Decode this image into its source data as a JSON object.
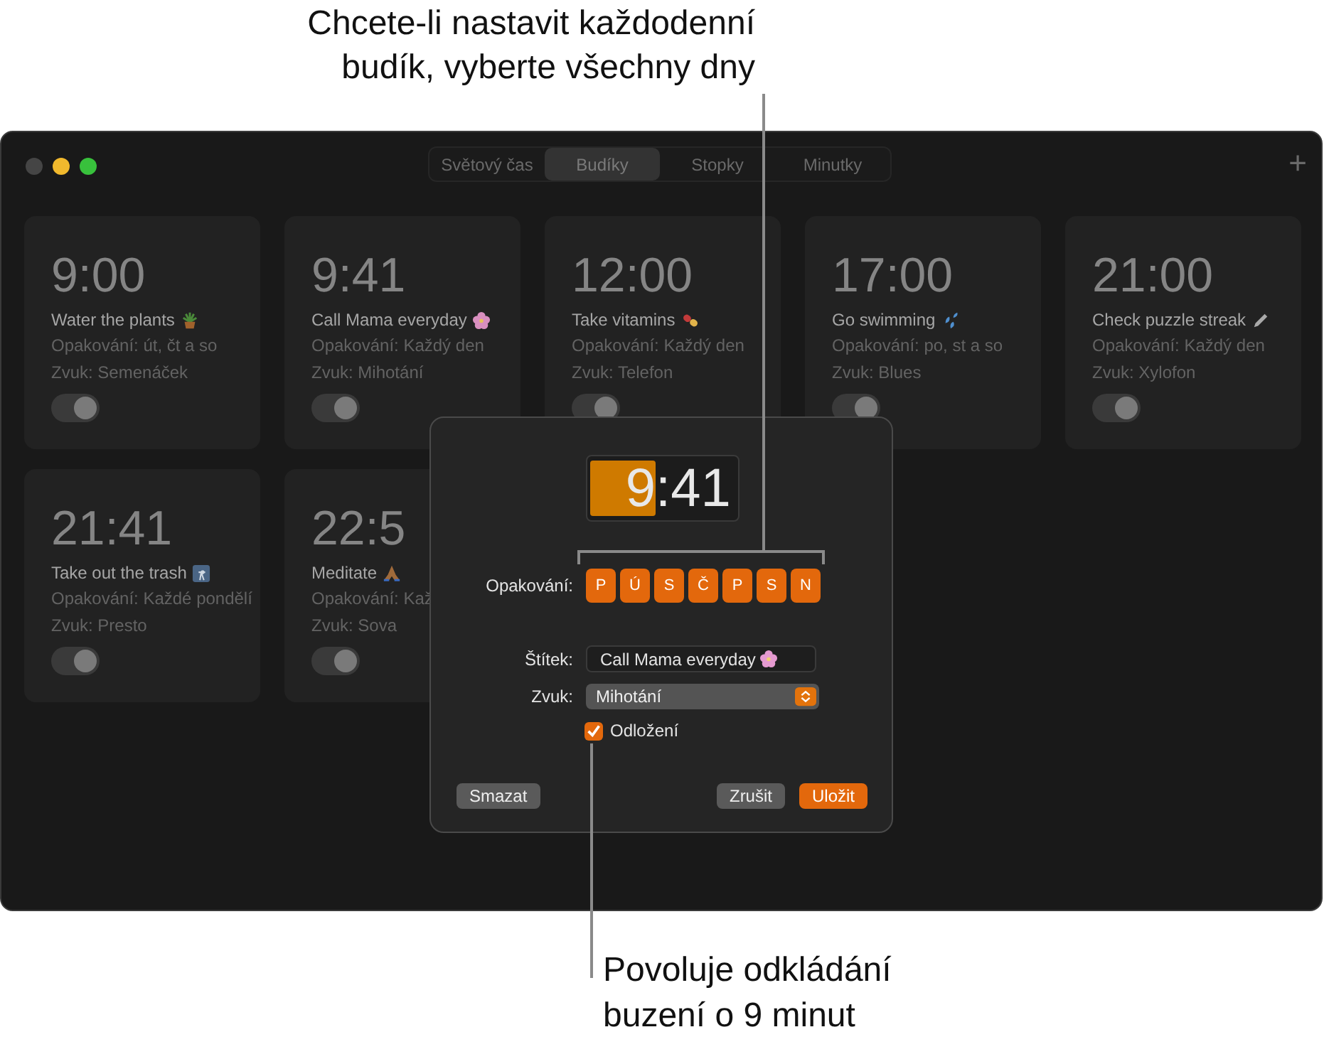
{
  "callouts": {
    "top": [
      "Chcete-li nastavit každodenní",
      "budík, vyberte všechny dny"
    ],
    "bottom": [
      "Povoluje odkládání",
      "buzení o 9 minut"
    ]
  },
  "window": {
    "tabs": [
      {
        "label": "Světový čas",
        "selected": false
      },
      {
        "label": "Budíky",
        "selected": true
      },
      {
        "label": "Stopky",
        "selected": false
      },
      {
        "label": "Minutky",
        "selected": false
      }
    ],
    "add_button": "+"
  },
  "alarms": [
    {
      "time": "9:00",
      "label": "Water the plants",
      "repeat": "Opakování: út, čt a so",
      "sound": "Zvuk: Semenáček",
      "on": true
    },
    {
      "time": "9:41",
      "label": "Call Mama everyday",
      "repeat": "Opakování: Každý den",
      "sound": "Zvuk: Mihotání",
      "on": true
    },
    {
      "time": "12:00",
      "label": "Take vitamins",
      "repeat": "Opakování: Každý den",
      "sound": "Zvuk: Telefon",
      "on": true
    },
    {
      "time": "17:00",
      "label": "Go swimming",
      "repeat": "Opakování: po, st a so",
      "sound": "Zvuk: Blues",
      "on": true
    },
    {
      "time": "21:00",
      "label": "Check puzzle streak",
      "repeat": "Opakování: Každý den",
      "sound": "Zvuk: Xylofon",
      "on": true
    },
    {
      "time": "21:41",
      "label": "Take out the trash",
      "repeat": "Opakování: Každé pondělí",
      "sound": "Zvuk: Presto",
      "on": true
    },
    {
      "time": "22:5",
      "label": "Meditate",
      "repeat": "Opakování: Kaž",
      "sound": "Zvuk: Sova",
      "on": true
    }
  ],
  "dialog": {
    "hour": "9",
    "separator": ":",
    "minute": "41",
    "repeat_label": "Opakování:",
    "days": [
      {
        "label": "P",
        "selected": true
      },
      {
        "label": "Ú",
        "selected": true
      },
      {
        "label": "S",
        "selected": true
      },
      {
        "label": "Č",
        "selected": true
      },
      {
        "label": "P",
        "selected": true
      },
      {
        "label": "S",
        "selected": true
      },
      {
        "label": "N",
        "selected": true
      }
    ],
    "name_label": "Štítek:",
    "name_value": "Call Mama everyday",
    "sound_label": "Zvuk:",
    "sound_value": "Mihotání",
    "snooze": {
      "label": "Odložení",
      "checked": true
    },
    "buttons": {
      "delete": "Smazat",
      "cancel": "Zrušit",
      "save": "Uložit"
    }
  }
}
